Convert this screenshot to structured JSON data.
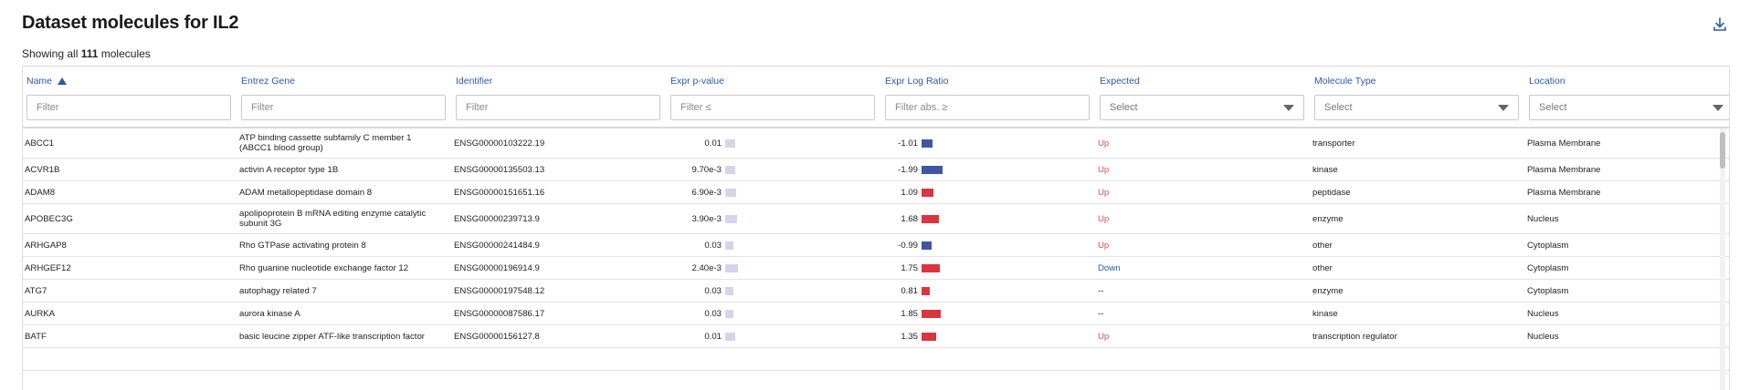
{
  "title": "Dataset molecules for IL2",
  "showing": {
    "prefix": "Showing all",
    "count": "111",
    "suffix": "molecules"
  },
  "columns": [
    {
      "label": "Name",
      "filter_type": "text",
      "placeholder": "Filter",
      "sorted": "asc"
    },
    {
      "label": "Entrez Gene",
      "filter_type": "text",
      "placeholder": "Filter"
    },
    {
      "label": "Identifier",
      "filter_type": "text",
      "placeholder": "Filter"
    },
    {
      "label": "Expr p-value",
      "filter_type": "text",
      "placeholder": "Filter ≤"
    },
    {
      "label": "Expr Log Ratio",
      "filter_type": "text",
      "placeholder": "Filter abs. ≥"
    },
    {
      "label": "Expected",
      "filter_type": "select",
      "placeholder": "Select"
    },
    {
      "label": "Molecule Type",
      "filter_type": "select",
      "placeholder": "Select"
    },
    {
      "label": "Location",
      "filter_type": "select",
      "placeholder": "Select"
    }
  ],
  "colors": {
    "link_blue": "#2a5aa8",
    "up_red": "#e24a3b",
    "bar_positive": "#d9363e",
    "bar_negative": "#3f56a6",
    "pvalue_bar": "#d3d6ea"
  },
  "rows": [
    {
      "name": "ABCC1",
      "gene": "ATP binding cassette subfamily C member 1 (ABCC1 blood group)",
      "id": "ENSG00000103222.19",
      "pval": "0.01",
      "pval_level": 0.5,
      "logratio": "-1.01",
      "logratio_value": -1.01,
      "expected": "Up",
      "type": "transporter",
      "location": "Plasma Membrane"
    },
    {
      "name": "ACVR1B",
      "gene": "activin A receptor type 1B",
      "id": "ENSG00000135503.13",
      "pval": "9.70e-3",
      "pval_level": 0.5,
      "logratio": "-1.99",
      "logratio_value": -1.99,
      "expected": "Up",
      "type": "kinase",
      "location": "Plasma Membrane"
    },
    {
      "name": "ADAM8",
      "gene": "ADAM metallopeptidase domain 8",
      "id": "ENSG00000151651.16",
      "pval": "6.90e-3",
      "pval_level": 0.55,
      "logratio": "1.09",
      "logratio_value": 1.09,
      "expected": "Up",
      "type": "peptidase",
      "location": "Plasma Membrane"
    },
    {
      "name": "APOBEC3G",
      "gene": "apolipoprotein B mRNA editing enzyme catalytic subunit 3G",
      "id": "ENSG00000239713.9",
      "pval": "3.90e-3",
      "pval_level": 0.6,
      "logratio": "1.68",
      "logratio_value": 1.68,
      "expected": "Up",
      "type": "enzyme",
      "location": "Nucleus"
    },
    {
      "name": "ARHGAP8",
      "gene": "Rho GTPase activating protein 8",
      "id": "ENSG00000241484.9",
      "pval": "0.03",
      "pval_level": 0.42,
      "logratio": "-0.99",
      "logratio_value": -0.99,
      "expected": "Up",
      "type": "other",
      "location": "Cytoplasm"
    },
    {
      "name": "ARHGEF12",
      "gene": "Rho guanine nucleotide exchange factor 12",
      "id": "ENSG00000196914.9",
      "pval": "2.40e-3",
      "pval_level": 0.65,
      "logratio": "1.75",
      "logratio_value": 1.75,
      "expected": "Down",
      "type": "other",
      "location": "Cytoplasm"
    },
    {
      "name": "ATG7",
      "gene": "autophagy related 7",
      "id": "ENSG00000197548.12",
      "pval": "0.03",
      "pval_level": 0.42,
      "logratio": "0.81",
      "logratio_value": 0.81,
      "expected": "--",
      "type": "enzyme",
      "location": "Cytoplasm"
    },
    {
      "name": "AURKA",
      "gene": "aurora kinase A",
      "id": "ENSG00000087586.17",
      "pval": "0.03",
      "pval_level": 0.42,
      "logratio": "1.85",
      "logratio_value": 1.85,
      "expected": "--",
      "type": "kinase",
      "location": "Nucleus"
    },
    {
      "name": "BATF",
      "gene": "basic leucine zipper ATF-like transcription factor",
      "id": "ENSG00000156127.8",
      "pval": "0.01",
      "pval_level": 0.5,
      "logratio": "1.35",
      "logratio_value": 1.35,
      "expected": "Up",
      "type": "transcription regulator",
      "location": "Nucleus"
    }
  ]
}
